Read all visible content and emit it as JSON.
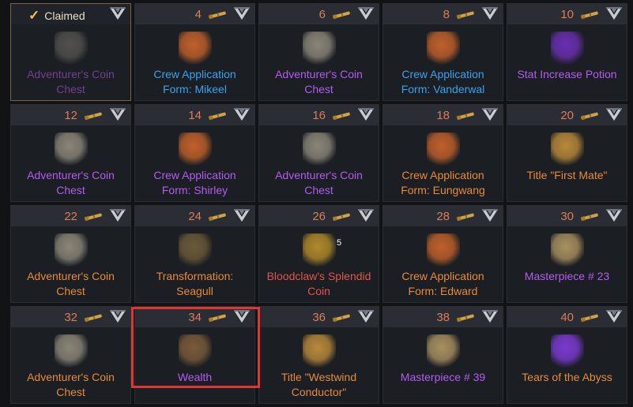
{
  "claimed_label": "Claimed",
  "colors": {
    "level": "#e07a5a",
    "purple": "#b45cf0",
    "blue": "#3aa3f0",
    "orange": "#e88a3c",
    "red": "#e0564a",
    "selection": "#e03535"
  },
  "rewards": [
    {
      "level": "",
      "claimed": true,
      "name": "Adventurer's Coin Chest",
      "tier": "purple",
      "icon": "coin-chest-icon",
      "bg": "#7e7a70"
    },
    {
      "level": "4",
      "name": "Crew Application Form: Mikeel",
      "tier": "blue",
      "icon": "application-form-icon",
      "bg": "#c0602a"
    },
    {
      "level": "6",
      "name": "Adventurer's Coin Chest",
      "tier": "purple",
      "icon": "coin-chest-icon",
      "bg": "#8a8578"
    },
    {
      "level": "8",
      "name": "Crew Application Form: Vanderwal",
      "tier": "blue",
      "icon": "application-form-icon",
      "bg": "#c0602a"
    },
    {
      "level": "10",
      "name": "Stat Increase Potion",
      "tier": "purple",
      "icon": "potion-icon",
      "bg": "#6a2fb0"
    },
    {
      "level": "12",
      "name": "Adventurer's Coin Chest",
      "tier": "purple",
      "icon": "coin-chest-icon",
      "bg": "#8a8578"
    },
    {
      "level": "14",
      "name": "Crew Application Form: Shirley",
      "tier": "purple",
      "icon": "application-form-icon",
      "bg": "#c0602a"
    },
    {
      "level": "16",
      "name": "Adventurer's Coin Chest",
      "tier": "purple",
      "icon": "coin-chest-icon",
      "bg": "#8a8578"
    },
    {
      "level": "18",
      "name": "Crew Application Form: Eungwang",
      "tier": "orange",
      "icon": "application-form-icon",
      "bg": "#c0602a"
    },
    {
      "level": "20",
      "name": "Title \"First Mate\"",
      "tier": "orange",
      "icon": "scroll-icon",
      "bg": "#b8893a"
    },
    {
      "level": "22",
      "name": "Adventurer's Coin Chest",
      "tier": "orange",
      "icon": "coin-chest-icon",
      "bg": "#8a8578"
    },
    {
      "level": "24",
      "name": "Transformation: Seagull",
      "tier": "orange",
      "icon": "seagull-icon",
      "bg": "#6b5a3a"
    },
    {
      "level": "26",
      "name": "Bloodclaw's Splendid Coin",
      "tier": "red",
      "icon": "gold-coin-icon",
      "bg": "#b08a2a",
      "count": "5"
    },
    {
      "level": "28",
      "name": "Crew Application Form: Edward",
      "tier": "orange",
      "icon": "application-form-icon",
      "bg": "#c0602a"
    },
    {
      "level": "30",
      "name": "Masterpiece # 23",
      "tier": "purple",
      "icon": "masterpiece-icon",
      "bg": "#a89060"
    },
    {
      "level": "32",
      "name": "Adventurer's Coin Chest",
      "tier": "orange",
      "icon": "coin-chest-icon",
      "bg": "#8a8578"
    },
    {
      "level": "34",
      "name": "Wealth",
      "tier": "purple",
      "icon": "wealth-rune-icon",
      "bg": "#7a5a3a"
    },
    {
      "level": "36",
      "name": "Title \"Westwind Conductor\"",
      "tier": "orange",
      "icon": "scroll-icon",
      "bg": "#b8893a"
    },
    {
      "level": "38",
      "name": "Masterpiece # 39",
      "tier": "purple",
      "icon": "masterpiece-icon",
      "bg": "#a89060"
    },
    {
      "level": "40",
      "name": "Tears of the Abyss",
      "tier": "orange",
      "icon": "gem-icon",
      "bg": "#7a3ad0"
    }
  ]
}
